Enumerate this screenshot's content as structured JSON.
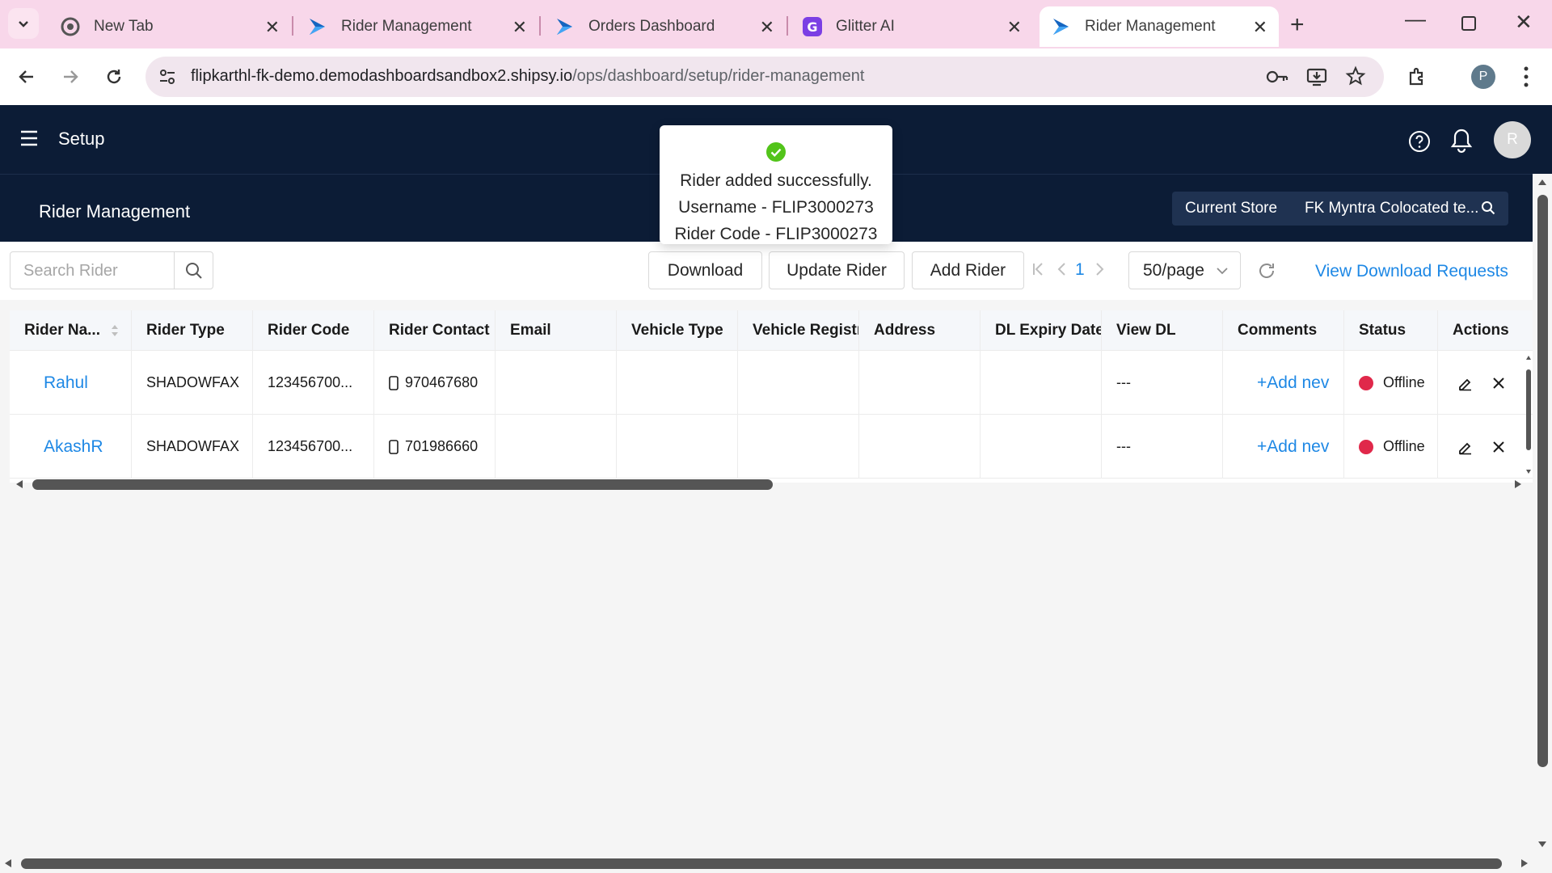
{
  "browser": {
    "tabs": [
      {
        "title": "New Tab",
        "icon": "chrome-icon",
        "active": false
      },
      {
        "title": "Rider Management",
        "icon": "shipsy-logo-icon",
        "active": false
      },
      {
        "title": "Orders Dashboard",
        "icon": "shipsy-logo-icon",
        "active": false
      },
      {
        "title": "Glitter AI",
        "icon": "glitter-logo-icon",
        "active": false
      },
      {
        "title": "Rider Management",
        "icon": "shipsy-logo-icon",
        "active": true
      }
    ],
    "url_host": "flipkarthl-fk-demo.demodashboardsandbox2.shipsy.io",
    "url_path": "/ops/dashboard/setup/rider-management",
    "profile_initial": "P"
  },
  "header": {
    "title": "Setup",
    "avatar_initial": "R"
  },
  "subheader": {
    "page_title": "Rider Management",
    "store_label": "Current Store",
    "store_value": "FK Myntra Colocated te..."
  },
  "toolbar": {
    "search_placeholder": "Search Rider",
    "download_label": "Download",
    "update_label": "Update Rider",
    "add_label": "Add Rider",
    "page_number": "1",
    "page_size": "50/page",
    "view_requests_label": "View Download Requests"
  },
  "table": {
    "columns": [
      "Rider Na...",
      "Rider Type",
      "Rider Code",
      "Rider Contact",
      "Email",
      "Vehicle Type",
      "Vehicle Registrat",
      "Address",
      "DL Expiry Date",
      "View DL",
      "Comments",
      "Status",
      "Actions"
    ],
    "rows": [
      {
        "name": "Rahul",
        "type": "SHADOWFAX",
        "code": "123456700...",
        "contact": "970467680",
        "email": "",
        "vehicle_type": "",
        "vehicle_reg": "",
        "address": "",
        "dl_expiry": "",
        "view_dl": "---",
        "comments": "+Add nev",
        "status": "Offline"
      },
      {
        "name": "AkashR",
        "type": "SHADOWFAX",
        "code": "123456700...",
        "contact": "701986660",
        "email": "",
        "vehicle_type": "",
        "vehicle_reg": "",
        "address": "",
        "dl_expiry": "",
        "view_dl": "---",
        "comments": "+Add nev",
        "status": "Offline"
      }
    ]
  },
  "toast": {
    "line1": "Rider added successfully.",
    "line2": "Username - FLIP3000273",
    "line3": "Rider Code - FLIP3000273"
  },
  "colors": {
    "header_bg": "#0c1c36",
    "link": "#1e88e5",
    "offline": "#e0284a",
    "success": "#52c41a"
  }
}
